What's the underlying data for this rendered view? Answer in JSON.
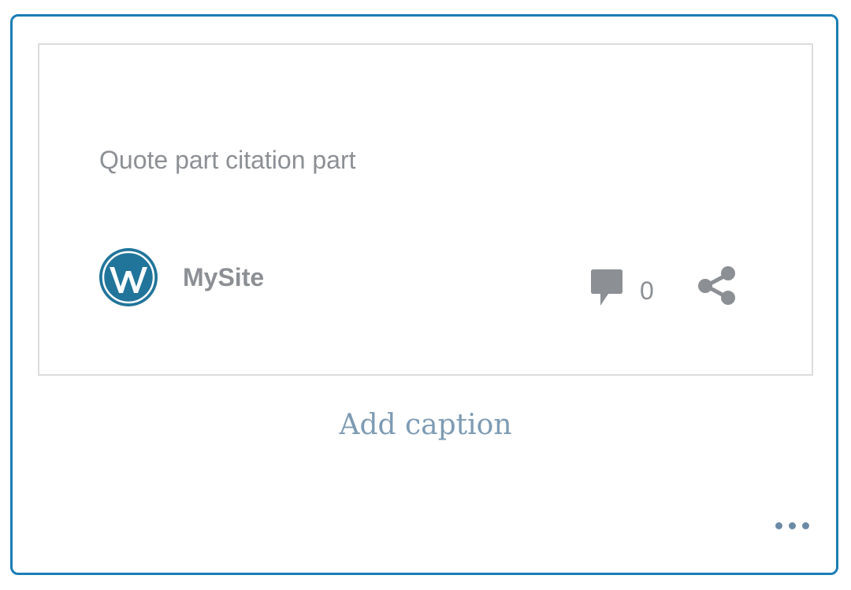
{
  "embed": {
    "quote_text": "Quote part citation part",
    "site_name": "MySite",
    "comment_count": "0",
    "logo_icon": "wordpress-logo-icon",
    "comment_icon": "comment-bubble-icon",
    "share_icon": "share-icon"
  },
  "caption": {
    "placeholder": "Add caption"
  },
  "toolbar": {
    "more_icon": "more-horizontal-icon"
  },
  "colors": {
    "block_border": "#1a7db5",
    "card_border": "#dcdcde",
    "text_muted": "#8c8f94",
    "wordpress_blue": "#21759b",
    "caption_placeholder": "#7d9bb4"
  }
}
